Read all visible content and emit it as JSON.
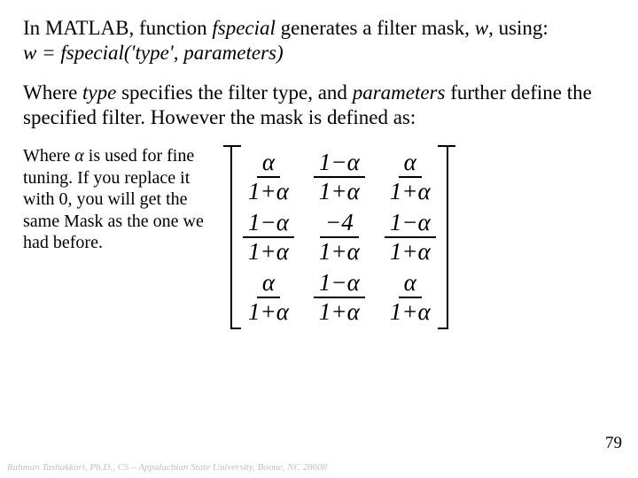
{
  "paragraph1": {
    "pre": "In MATLAB, function ",
    "func": "fspecial",
    "mid": " generates a filter mask, ",
    "var": "w",
    "post": ", using:",
    "eq": "w = fspecial('type', parameters)"
  },
  "paragraph2": {
    "pre": "Where ",
    "t1": "type",
    "mid": " specifies the filter type, and ",
    "t2": "parameters",
    "post": " further define the specified filter.  However the mask is defined as:"
  },
  "leftnote": {
    "pre": "Where ",
    "alpha": "α",
    "rest": " is used for fine tuning.  If you replace it with 0, you will get the same Mask as the one we had before."
  },
  "matrix": {
    "cells": [
      {
        "num": "α",
        "den": "1+α"
      },
      {
        "num": "1−α",
        "den": "1+α"
      },
      {
        "num": "α",
        "den": "1+α"
      },
      {
        "num": "1−α",
        "den": "1+α"
      },
      {
        "num": "−4",
        "den": "1+α"
      },
      {
        "num": "1−α",
        "den": "1+α"
      },
      {
        "num": "α",
        "den": "1+α"
      },
      {
        "num": "1−α",
        "den": "1+α"
      },
      {
        "num": "α",
        "den": "1+α"
      }
    ]
  },
  "pagenum": "79",
  "footer": "Rahman Tashakkori, Ph.D., CS – Appalachian State University, Boone, NC 28608"
}
